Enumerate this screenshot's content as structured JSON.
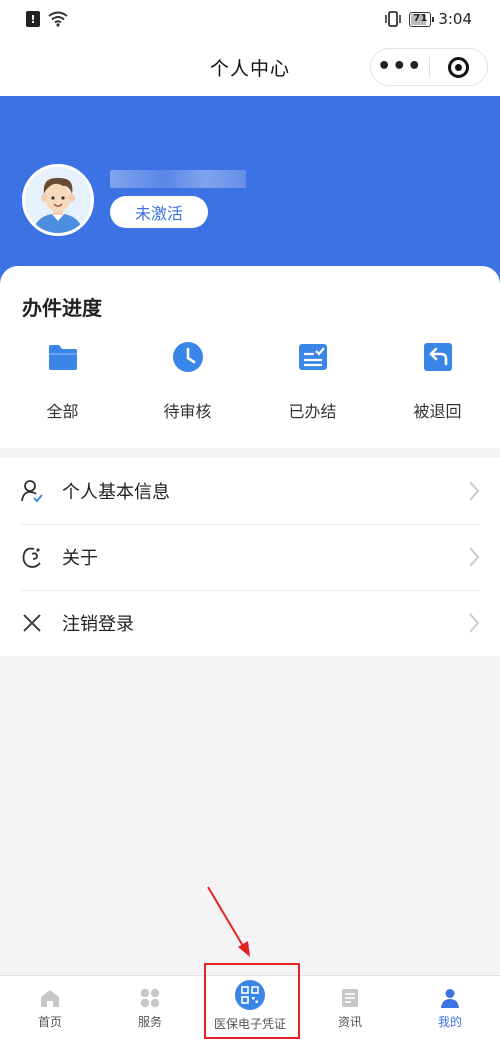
{
  "status_bar": {
    "time": "3:04",
    "battery": "71"
  },
  "nav": {
    "title": "个人中心"
  },
  "profile": {
    "status_badge": "未激活"
  },
  "progress": {
    "title": "办件进度",
    "items": [
      {
        "label": "全部",
        "icon": "folder-icon"
      },
      {
        "label": "待审核",
        "icon": "clock-icon"
      },
      {
        "label": "已办结",
        "icon": "checked-list-icon"
      },
      {
        "label": "被退回",
        "icon": "return-icon"
      }
    ]
  },
  "menu": {
    "items": [
      {
        "label": "个人基本信息",
        "icon": "user-check-icon"
      },
      {
        "label": "关于",
        "icon": "about-icon"
      },
      {
        "label": "注销登录",
        "icon": "close-icon"
      }
    ]
  },
  "tabs": [
    {
      "label": "首页",
      "icon": "home-icon"
    },
    {
      "label": "服务",
      "icon": "grid-icon"
    },
    {
      "label": "医保电子凭证",
      "icon": "qr-code-icon"
    },
    {
      "label": "资讯",
      "icon": "news-icon"
    },
    {
      "label": "我的",
      "icon": "user-icon"
    }
  ],
  "colors": {
    "brand_blue": "#3d72e4",
    "annotation_red": "#e52323"
  }
}
